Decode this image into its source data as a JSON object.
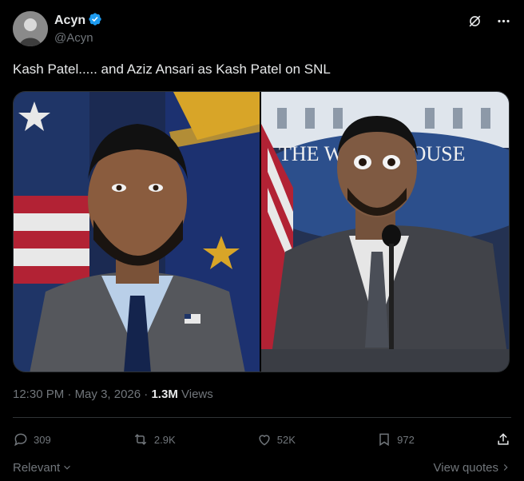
{
  "author": {
    "display_name": "Acyn",
    "handle": "@Acyn",
    "verified": true,
    "verified_color": "#1d9bf0"
  },
  "header_icons": [
    "grok-icon",
    "more-icon"
  ],
  "tweet": {
    "text": "Kash Patel..... and Aziz Ansari as Kash Patel on SNL",
    "time": "12:30 PM",
    "separator": "·",
    "date": "May 3, 2026",
    "views_count": "1.3M",
    "views_label": "Views"
  },
  "media": {
    "left_photo": "Official portrait with flag background",
    "right_photo": "SNL press briefing sketch",
    "sign_text": "THE WHITE HOUSE"
  },
  "actions": {
    "replies": "309",
    "reposts": "2.9K",
    "likes": "52K",
    "bookmarks": "972"
  },
  "footer": {
    "sort_label": "Relevant",
    "view_quotes_label": "View quotes"
  },
  "colors": {
    "background": "#000000",
    "text": "#e7e9ea",
    "muted": "#71767b",
    "border": "#2f3336"
  }
}
